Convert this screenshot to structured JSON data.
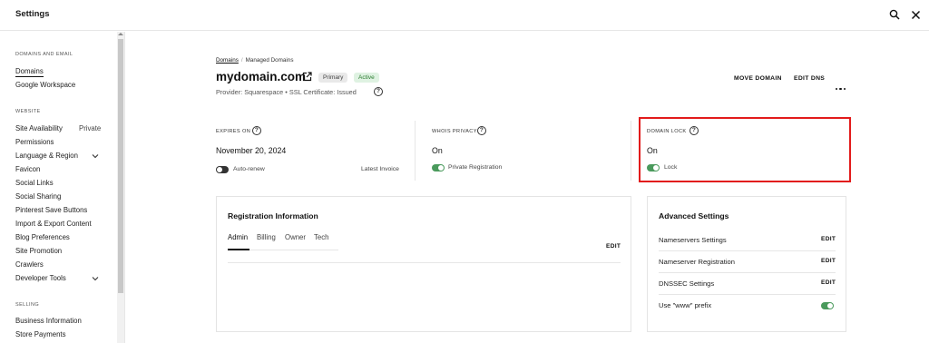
{
  "header": {
    "title": "Settings",
    "search_icon": "search-icon",
    "close_icon": "close-icon"
  },
  "sidebar": {
    "domains_section": "DOMAINS AND EMAIL",
    "domains_items": [
      "Domains",
      "Google Workspace"
    ],
    "website_section": "WEBSITE",
    "website_items": [
      "Site Availability",
      "Permissions",
      "Language & Region",
      "Favicon",
      "Social Links",
      "Social Sharing",
      "Pinterest Save Buttons",
      "Import & Export Content",
      "Blog Preferences",
      "Site Promotion",
      "Crawlers",
      "Developer Tools"
    ],
    "site_availability_status": "Private",
    "selling_section": "SELLING",
    "selling_items": [
      "Business Information",
      "Store Payments"
    ]
  },
  "breadcrumb": {
    "root": "Domains",
    "current": "Managed Domains"
  },
  "domain": {
    "name": "mydomain.com",
    "badge_primary": "Primary",
    "badge_active": "Active",
    "provider_line": "Provider: Squarespace • SSL Certificate: Issued"
  },
  "actions": {
    "move_domain": "MOVE DOMAIN",
    "edit_dns": "EDIT DNS"
  },
  "cards": {
    "expires": {
      "label": "EXPIRES ON",
      "value": "November 20, 2024",
      "toggle_label": "Auto-renew",
      "toggle_on": false,
      "link": "Latest Invoice"
    },
    "whois": {
      "label": "WHOIS PRIVACY",
      "value": "On",
      "toggle_label": "Private Registration",
      "toggle_on": true
    },
    "lock": {
      "label": "DOMAIN LOCK",
      "value": "On",
      "toggle_label": "Lock",
      "toggle_on": true
    }
  },
  "registration": {
    "title": "Registration Information",
    "tabs": [
      "Admin",
      "Billing",
      "Owner",
      "Tech"
    ],
    "active_tab": "Admin",
    "edit": "EDIT"
  },
  "advanced": {
    "title": "Advanced Settings",
    "rows": [
      {
        "label": "Nameservers Settings",
        "action": "EDIT"
      },
      {
        "label": "Nameserver Registration",
        "action": "EDIT"
      },
      {
        "label": "DNSSEC Settings",
        "action": "EDIT"
      },
      {
        "label": "Use \"www\" prefix",
        "toggle_on": true
      }
    ]
  },
  "colors": {
    "accent_green": "#4a9a5c",
    "highlight_red": "#e21b1b"
  }
}
